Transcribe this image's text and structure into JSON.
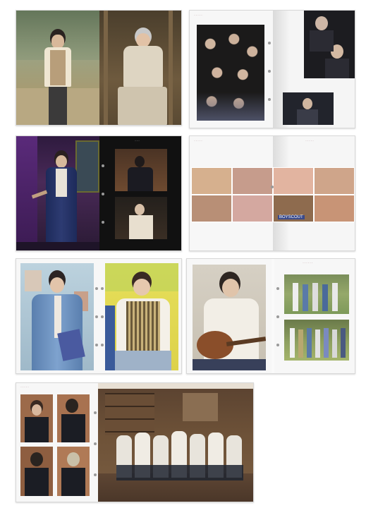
{
  "spreads": [
    {
      "id": "spread-1-portraits",
      "description_hidden": ""
    },
    {
      "id": "spread-2-group-collage"
    },
    {
      "id": "spread-3-stage"
    },
    {
      "id": "spread-4-concert-strip"
    },
    {
      "id": "spread-5-denim-portraits"
    },
    {
      "id": "spread-6-guitar-and-group"
    },
    {
      "id": "spread-7-suits"
    }
  ],
  "colors": {
    "page_white": "#f7f7f7",
    "page_dark": "#111111",
    "hole": "#9a9a9a",
    "border": "#d8d8d8"
  },
  "labels": {
    "book_banner": "BOYSCOUT"
  }
}
